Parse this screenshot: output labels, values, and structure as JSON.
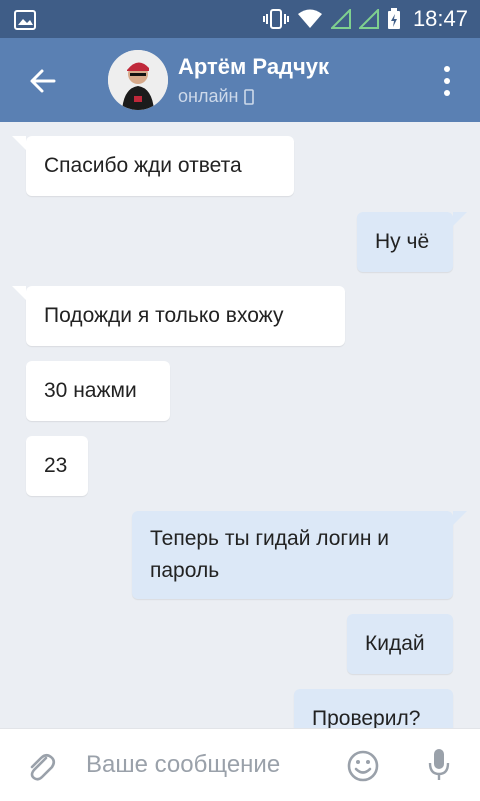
{
  "status_bar": {
    "time": "18:47"
  },
  "header": {
    "name": "Артём Радчук",
    "status": "онлайн"
  },
  "messages": [
    {
      "text": "Спасибо жди ответа",
      "direction": "in"
    },
    {
      "text": "Ну чё",
      "direction": "out"
    },
    {
      "text": "Подожди я только вхожу",
      "direction": "in"
    },
    {
      "text": "30 нажми",
      "direction": "in"
    },
    {
      "text": "23",
      "direction": "in"
    },
    {
      "text": "Теперь ты гидай логин и пароль",
      "direction": "out"
    },
    {
      "text": "Кидай",
      "direction": "out"
    },
    {
      "text": "Проверил?",
      "direction": "out"
    }
  ],
  "composer": {
    "placeholder": "Ваше сообщение"
  },
  "colors": {
    "header": "#5a80b3",
    "status_bar": "#3f5d87",
    "background": "#ebeef3",
    "outgoing_bubble": "#dce8f7",
    "incoming_bubble": "#ffffff"
  },
  "icons": {
    "back": "arrow-left-icon",
    "menu": "more-vert-icon",
    "attach": "paperclip-icon",
    "emoji": "smile-icon",
    "mic": "microphone-icon",
    "phone": "phone-icon"
  }
}
